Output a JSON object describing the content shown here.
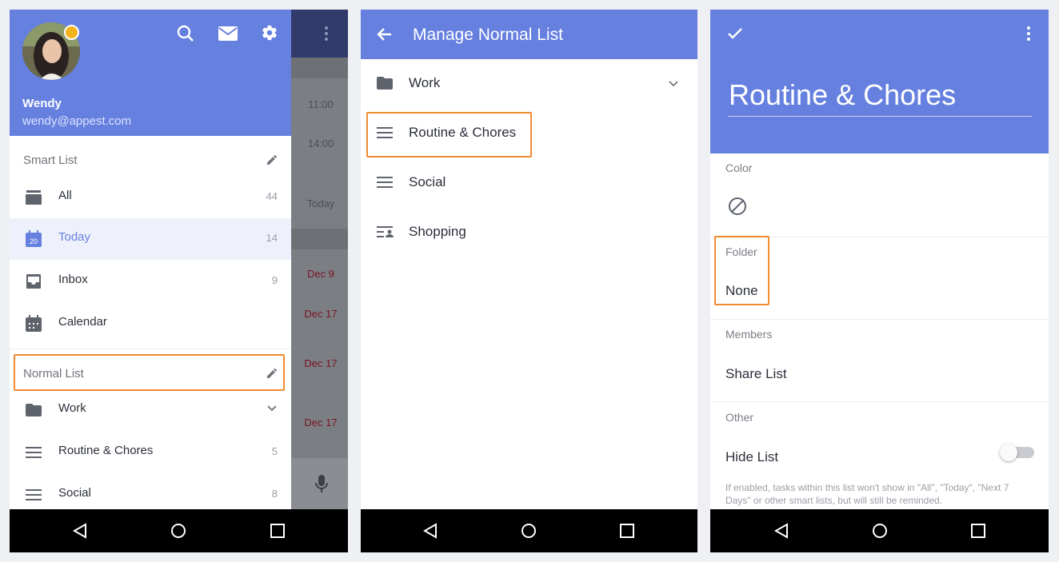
{
  "drawer": {
    "user": {
      "name": "Wendy",
      "email": "wendy@appest.com"
    },
    "behind_times": [
      "11:00",
      "14:00",
      "Today"
    ],
    "behind_dates": [
      "Dec 9",
      "Dec 17",
      "Dec 17",
      "Dec 17"
    ],
    "smart_list": {
      "header": "Smart List",
      "items": [
        {
          "label": "All",
          "count": "44",
          "icon": "stack-icon"
        },
        {
          "label": "Today",
          "count": "14",
          "icon": "calendar-today-icon",
          "day": "20"
        },
        {
          "label": "Inbox",
          "count": "9",
          "icon": "inbox-icon"
        },
        {
          "label": "Calendar",
          "count": "",
          "icon": "calendar-icon"
        }
      ]
    },
    "normal_list": {
      "header": "Normal List",
      "items": [
        {
          "label": "Work",
          "count": "",
          "icon": "folder-icon"
        },
        {
          "label": "Routine & Chores",
          "count": "5",
          "icon": "list-icon"
        },
        {
          "label": "Social",
          "count": "8",
          "icon": "list-icon"
        }
      ]
    }
  },
  "manage": {
    "title": "Manage Normal List",
    "items": [
      {
        "label": "Work",
        "icon": "folder-icon"
      },
      {
        "label": "Routine & Chores",
        "icon": "list-icon"
      },
      {
        "label": "Social",
        "icon": "list-icon"
      },
      {
        "label": "Shopping",
        "icon": "shared-list-icon"
      }
    ]
  },
  "edit": {
    "title": "Routine & Chores",
    "color_label": "Color",
    "folder_label": "Folder",
    "folder_value": "None",
    "members_label": "Members",
    "share_label": "Share List",
    "other_label": "Other",
    "hide_label": "Hide List",
    "hide_enabled": false,
    "hide_note": "If enabled, tasks within this list won't show in \"All\", \"Today\", \"Next 7 Days\" or other smart lists, but will still be reminded."
  },
  "colors": {
    "accent": "#6680e0",
    "highlight": "#f28a30",
    "today_bg": "#eef1fb"
  }
}
